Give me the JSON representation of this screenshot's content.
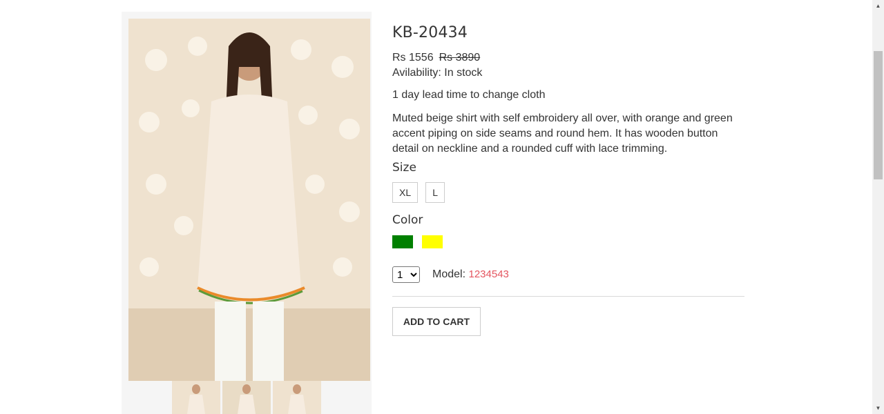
{
  "product": {
    "title": "KB-20434",
    "price": "Rs 1556",
    "old_price": "Rs 3890",
    "availability": "Avilability: In stock",
    "lead_time": "1 day lead time to change cloth",
    "description": "Muted beige shirt with self embroidery all over, with orange and green accent piping on side seams and round hem. It has wooden button detail on neckline and a rounded cuff with lace trimming.",
    "size_label": "Size",
    "sizes": [
      "XL",
      "L"
    ],
    "color_label": "Color",
    "colors": [
      "#008000",
      "#ffff00"
    ],
    "quantity": "1",
    "model_label": "Model:",
    "model_value": "1234543",
    "add_to_cart": "ADD TO CART"
  },
  "gallery": {
    "main_image_icon": "product-photo",
    "thumbnails": [
      "product-thumbnail",
      "product-thumbnail",
      "product-thumbnail"
    ]
  },
  "scrollbar": {
    "up_icon": "chevron-up-icon",
    "down_icon": "chevron-down-icon"
  }
}
